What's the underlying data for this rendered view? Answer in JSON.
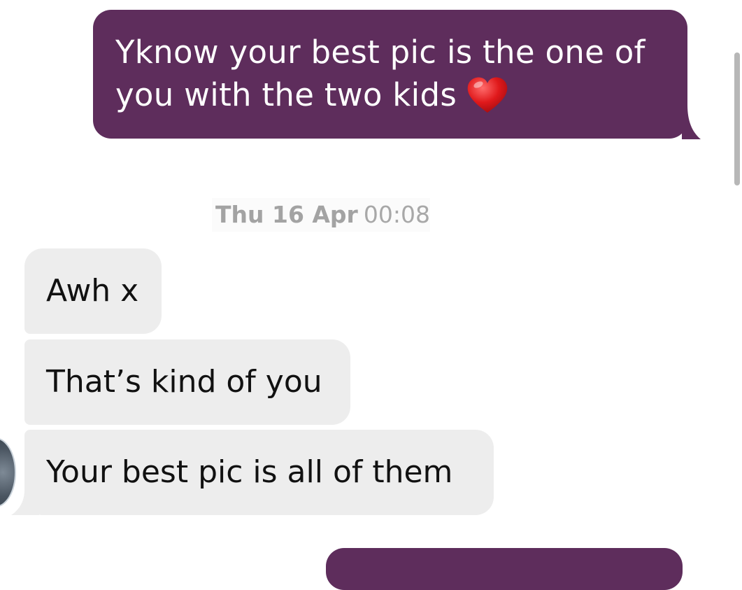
{
  "conversation": {
    "outgoing_message": {
      "line1": "Yknow your best pic is the one of",
      "line2": "you with the two kids",
      "emoji": "❤️",
      "emoji_icon": "red-heart-icon"
    },
    "date_separator": {
      "day": "Thu 16 Apr",
      "time": "00:08"
    },
    "incoming_messages": [
      {
        "text": "Awh x"
      },
      {
        "text": "That’s kind of you"
      },
      {
        "text": "Your best pic is all of them"
      }
    ]
  },
  "colors": {
    "outgoing_bubble": "#5e2d5c",
    "incoming_bubble": "#ededed",
    "timestamp_text": "#a3a3a3"
  }
}
